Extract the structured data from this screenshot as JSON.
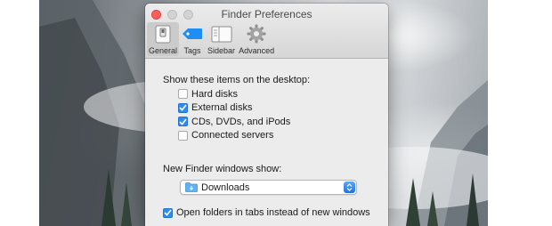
{
  "window": {
    "title": "Finder Preferences"
  },
  "toolbar": {
    "tabs": [
      {
        "label": "General",
        "icon": "general-switch-icon",
        "selected": true
      },
      {
        "label": "Tags",
        "icon": "tag-icon",
        "selected": false
      },
      {
        "label": "Sidebar",
        "icon": "sidebar-icon",
        "selected": false
      },
      {
        "label": "Advanced",
        "icon": "gear-icon",
        "selected": false
      }
    ]
  },
  "desktop_section": {
    "label": "Show these items on the desktop:",
    "items": [
      {
        "label": "Hard disks",
        "checked": false
      },
      {
        "label": "External disks",
        "checked": true
      },
      {
        "label": "CDs, DVDs, and iPods",
        "checked": true
      },
      {
        "label": "Connected servers",
        "checked": false
      }
    ]
  },
  "new_window": {
    "label": "New Finder windows show:",
    "selected": "Downloads",
    "icon": "downloads-folder-icon"
  },
  "tabs_option": {
    "label": "Open folders in tabs instead of new windows",
    "checked": true
  },
  "colors": {
    "accent": "#2e8cf0",
    "close_button": "#fc605c",
    "window_bg": "#ececec"
  }
}
